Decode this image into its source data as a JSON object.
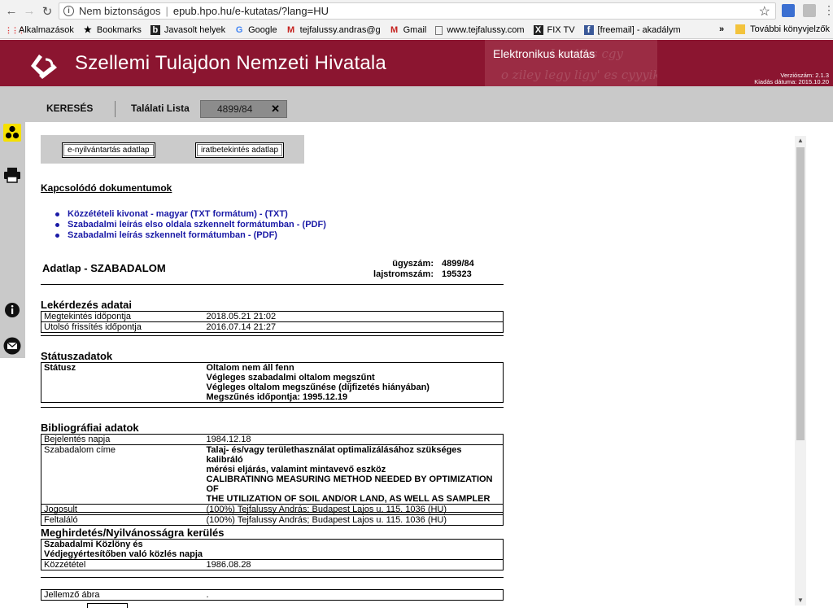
{
  "browser": {
    "insecure_label": "Nem biztonságos",
    "url": "epub.hpo.hu/e-kutatas/?lang=HU",
    "bookmarks": [
      {
        "label": "Alkalmazások",
        "icon": "apps-icon"
      },
      {
        "label": "Bookmarks",
        "icon": "star-icon"
      },
      {
        "label": "Javasolt helyek",
        "icon": "bing-icon"
      },
      {
        "label": "Google",
        "icon": "google-icon"
      },
      {
        "label": "tejfalussy.andras@g",
        "icon": "gmail-icon"
      },
      {
        "label": "Gmail",
        "icon": "gmail-icon"
      },
      {
        "label": "www.tejfalussy.com",
        "icon": "page-icon"
      },
      {
        "label": "FIX TV",
        "icon": "fixtv-icon"
      },
      {
        "label": "[freemail] - akadálym",
        "icon": "facebook-icon"
      }
    ],
    "more_bookmarks": "»",
    "other_bookmarks": "További könyvjelzők"
  },
  "header": {
    "title": "Szellemi Tulajdon Nemzeti Hivatala",
    "subtitle": "Elektronikus kutatás",
    "version_line": "Verziószám: 2.1.3",
    "release_line": "Kiadás dátuma: 2015.10.20"
  },
  "tabs": {
    "search": "KERESÉS",
    "results": "Találati Lista",
    "active": "4899/84",
    "close": "✕"
  },
  "buttons": {
    "registry": "e-nyilvántartás adatlap",
    "docs": "iratbetekintés adatlap"
  },
  "related": {
    "title": "Kapcsolódó dokumentumok",
    "items": [
      "Közzétételi kivonat - magyar (TXT formátum) - (TXT)",
      "Szabadalmi leírás elso oldala szkennelt formátumban - (PDF)",
      "Szabadalmi leírás szkennelt formátumban - (PDF)"
    ]
  },
  "datasheet": {
    "title": "Adatlap - SZABADALOM",
    "case_label": "ügyszám:",
    "case_value": "4899/84",
    "reg_label": "lajstromszám:",
    "reg_value": "195323"
  },
  "query": {
    "title": "Lekérdezés adatai",
    "rows": [
      {
        "k": "Megtekintés időpontja",
        "v": "2018.05.21 21:02"
      },
      {
        "k": "Utolsó frissítés időpontja",
        "v": "2016.07.14 21:27"
      }
    ]
  },
  "status": {
    "title": "Státuszadatok",
    "label": "Státusz",
    "lines": [
      "Oltalom nem áll fenn",
      "Végleges szabadalmi oltalom megszűnt",
      "Végleges oltalom megszűnése (díjfizetés hiányában)",
      "Megszűnés időpontja: 1995.12.19"
    ]
  },
  "biblio": {
    "title": "Bibliográfiai adatok",
    "filing_label": "Bejelentés napja",
    "filing_value": "1984.12.18",
    "title_label": "Szabadalom címe",
    "title_lines": [
      "Talaj- és/vagy területhasználat optimalizálásához szükséges kalibráló",
      "mérési eljárás, valamint mintavevő eszköz",
      "CALIBRATINNG MEASURING METHOD NEEDED BY OPTIMIZATION OF",
      "THE UTILIZATION OF SOIL AND/OR LAND, AS WELL AS SAMPLER"
    ],
    "owner_label": "Jogosult",
    "owner_value": "(100%) Tejfalussy András; Budapest Lajos u. 115. 1036 (HU)",
    "inventor_label": "Feltaláló",
    "inventor_value": "(100%) Tejfalussy András; Budapest Lajos u. 115. 1036 (HU)"
  },
  "publication": {
    "title": "Meghirdetés/Nyilvánosságra kerülés",
    "header_line1": "Szabadalmi Közlöny és",
    "header_line2": "Védjegyértesítőben való közlés napja",
    "pub_label": "Közzététel",
    "pub_value": "1986.08.28"
  },
  "figure": {
    "label": "Jellemző ábra",
    "value": "."
  },
  "colors": {
    "brand": "#8b1530",
    "link": "#1a1aa6",
    "toolbar": "#c9c9c9"
  }
}
